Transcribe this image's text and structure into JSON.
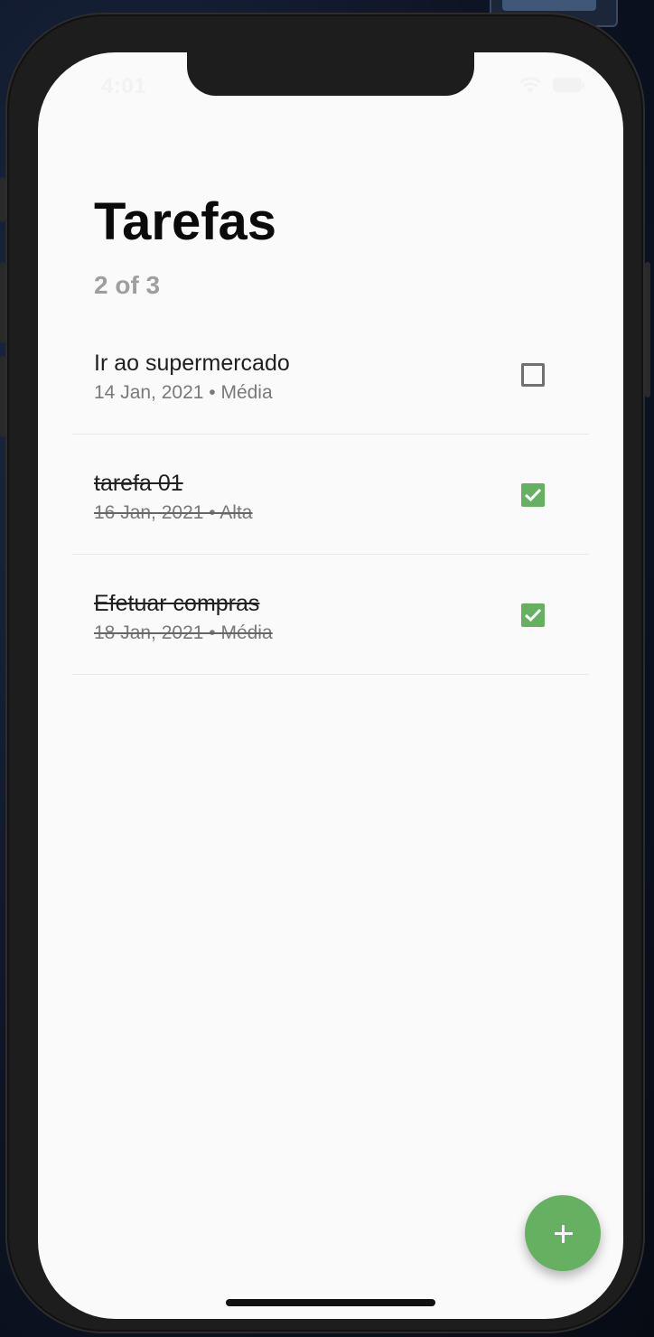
{
  "status_bar": {
    "time": "4:01",
    "wifi_icon": "wifi-icon",
    "battery_icon": "battery-icon"
  },
  "header": {
    "title": "Tarefas",
    "progress": "2 of 3"
  },
  "tasks": [
    {
      "title": "Ir ao supermercado",
      "meta": "14 Jan, 2021 • Média",
      "done": false
    },
    {
      "title": "tarefa 01",
      "meta": "16 Jan, 2021 • Alta",
      "done": true
    },
    {
      "title": "Efetuar compras",
      "meta": "18 Jan, 2021 • Média",
      "done": true
    }
  ],
  "fab": {
    "icon": "plus-icon"
  },
  "colors": {
    "accent": "#66b061",
    "background": "#fafafa",
    "title": "#0a0a0a",
    "muted": "#9e9e9e"
  }
}
